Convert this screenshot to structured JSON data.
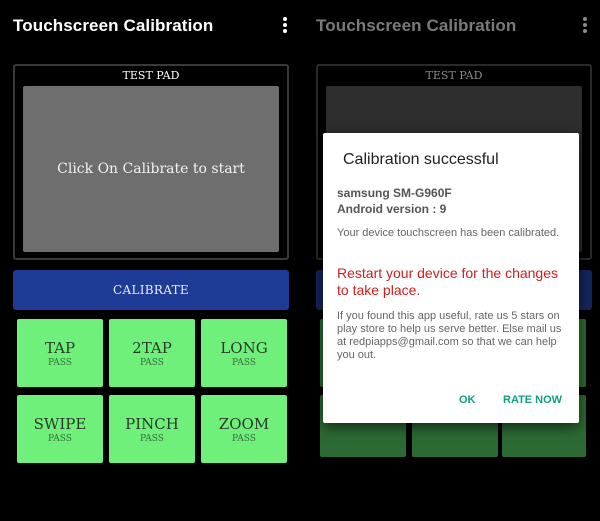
{
  "app": {
    "title": "Touchscreen Calibration"
  },
  "testpad": {
    "title": "TEST PAD",
    "prompt": "Click On Calibrate to start"
  },
  "calibrate": {
    "label": "CALIBRATE"
  },
  "tiles": [
    {
      "label": "TAP",
      "status": "PASS"
    },
    {
      "label": "2TAP",
      "status": "PASS"
    },
    {
      "label": "LONG",
      "status": "PASS"
    },
    {
      "label": "SWIPE",
      "status": "PASS"
    },
    {
      "label": "PINCH",
      "status": "PASS"
    },
    {
      "label": "ZOOM",
      "status": "PASS"
    }
  ],
  "dialog": {
    "title": "Calibration successful",
    "device": "samsung SM-G960F",
    "android": "Android version : 9",
    "message": "Your device touchscreen has been calibrated.",
    "warning": "Restart your device for the changes to take place.",
    "promo": "If you found this app useful, rate us 5 stars on play store to help us serve better. Else mail us at redpiapps@gmail.com so that we can help you out.",
    "ok_label": "OK",
    "rate_label": "RATE NOW"
  },
  "colors": {
    "accent": "#0f9f82",
    "calibrate": "#1e3c96",
    "tile": "#6ff07a",
    "warning": "#d51b1b"
  },
  "icons": {
    "overflow": "overflow-menu-icon"
  }
}
